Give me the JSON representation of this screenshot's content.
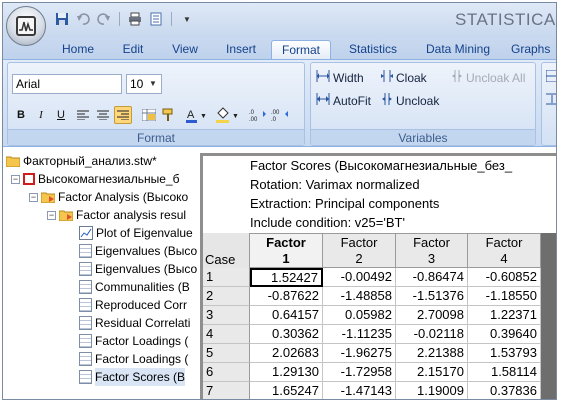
{
  "app": {
    "title": "STATISTICA -"
  },
  "tabs": [
    "Home",
    "Edit",
    "View",
    "Insert",
    "Format",
    "Statistics",
    "Data Mining",
    "Graphs"
  ],
  "active_tab": "Format",
  "format_group": {
    "label": "Format",
    "font_name": "Arial",
    "font_size": "10"
  },
  "variables_group": {
    "label": "Variables",
    "width_label": "Width",
    "cloak_label": "Cloak",
    "uncloak_all_label": "Uncloak All",
    "autofit_label": "AutoFit",
    "uncloak_label": "Uncloak"
  },
  "tree": {
    "items": [
      {
        "label": "Факторный_анализ.stw*"
      },
      {
        "label": "Высокомагнезиальные_б"
      },
      {
        "label": "Factor Analysis (Высоко"
      },
      {
        "label": "Factor analysis resul"
      },
      {
        "label": "Plot of Eigenvalue"
      },
      {
        "label": "Eigenvalues (Высо"
      },
      {
        "label": "Eigenvalues (Высо"
      },
      {
        "label": "Communalities (В"
      },
      {
        "label": "Reproduced Corr"
      },
      {
        "label": "Residual Correlati"
      },
      {
        "label": "Factor Loadings ("
      },
      {
        "label": "Factor Loadings ("
      },
      {
        "label": "Factor Scores (В"
      }
    ]
  },
  "sheet": {
    "info": [
      "Factor Scores (Высокомагнезиальные_без_",
      "Rotation: Varimax normalized",
      "Extraction: Principal components",
      "Include condition: v25='BT'"
    ],
    "case_label": "Case",
    "columns": [
      {
        "line1": "Factor",
        "line2": "1"
      },
      {
        "line1": "Factor",
        "line2": "2"
      },
      {
        "line1": "Factor",
        "line2": "3"
      },
      {
        "line1": "Factor",
        "line2": "4"
      }
    ],
    "rows": [
      {
        "case": "1",
        "values": [
          "1.52427",
          "-0.00492",
          "-0.86474",
          "-0.60852"
        ]
      },
      {
        "case": "2",
        "values": [
          "-0.87622",
          "-1.48858",
          "-1.51376",
          "-1.18550"
        ]
      },
      {
        "case": "3",
        "values": [
          "0.64157",
          "0.05982",
          "2.70098",
          "1.22371"
        ]
      },
      {
        "case": "4",
        "values": [
          "0.30362",
          "-1.11235",
          "-0.02118",
          "0.39640"
        ]
      },
      {
        "case": "5",
        "values": [
          "2.02683",
          "-1.96275",
          "2.21388",
          "1.53793"
        ]
      },
      {
        "case": "6",
        "values": [
          "1.29130",
          "-1.72958",
          "2.15170",
          "1.58114"
        ]
      },
      {
        "case": "7",
        "values": [
          "1.65247",
          "-1.47143",
          "1.19009",
          "0.37836"
        ]
      }
    ]
  }
}
